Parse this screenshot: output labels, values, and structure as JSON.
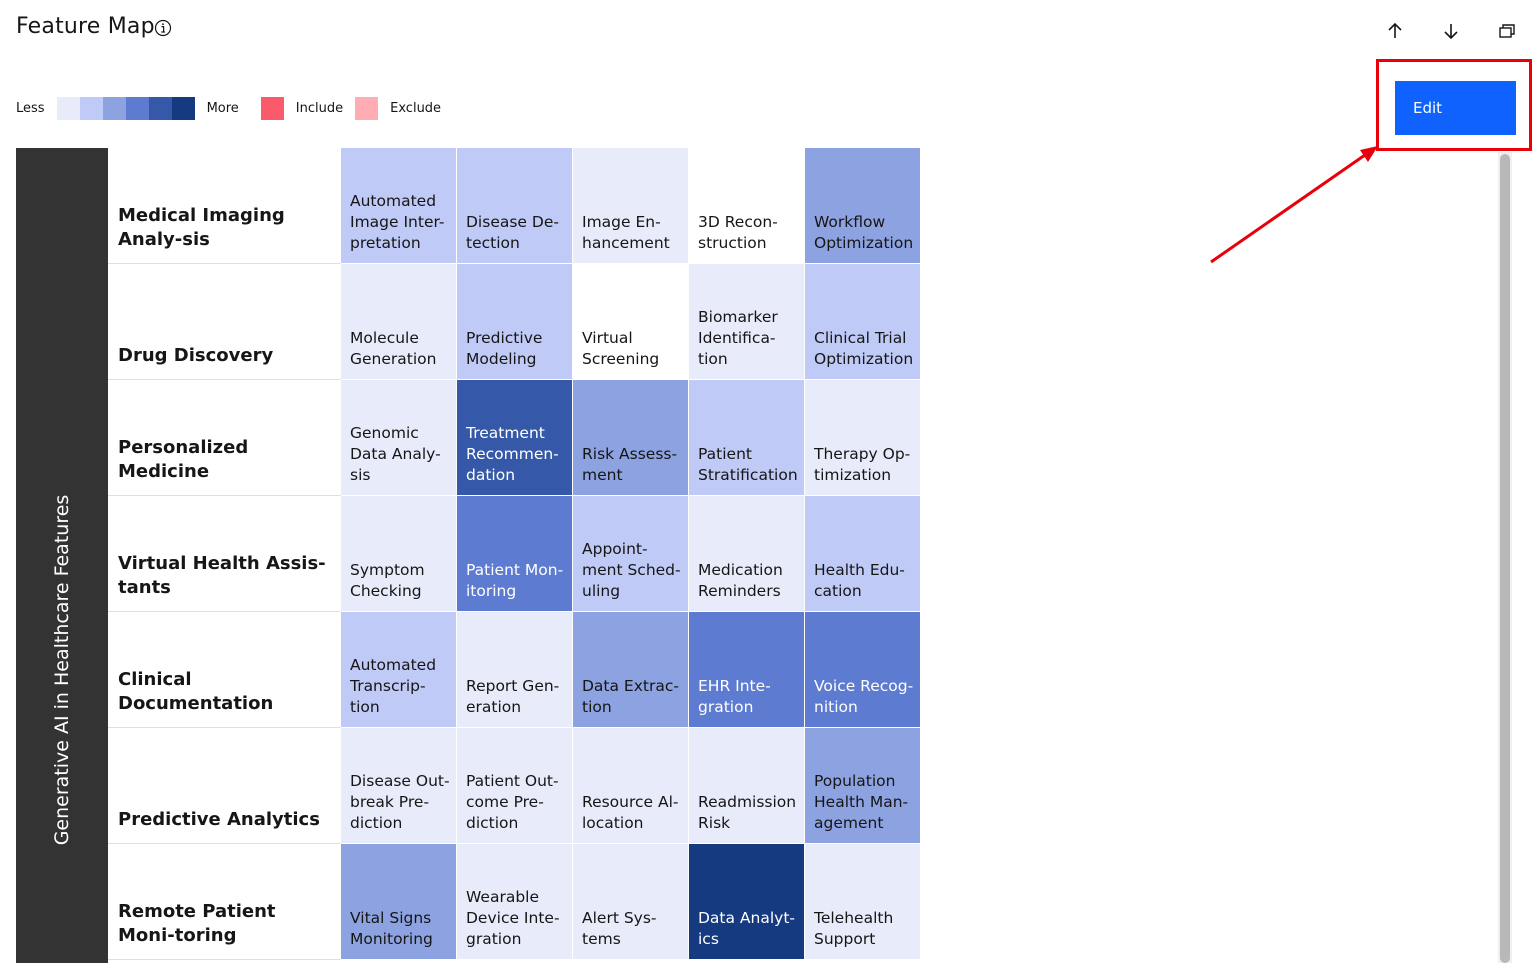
{
  "header": {
    "title": "Feature Map"
  },
  "legend": {
    "less": "Less",
    "more": "More",
    "scale_colors": [
      "#e8ebfa",
      "#bfcaf6",
      "#8da2e1",
      "#5d7bd0",
      "#3558a8",
      "#153a80"
    ],
    "include_label": "Include",
    "include_color": "#fa5a6a",
    "exclude_label": "Exclude",
    "exclude_color": "#ffadb3"
  },
  "toolbar": {
    "edit_label": "Edit",
    "accent_color": "#0f62fe"
  },
  "map": {
    "side_label": "Generative AI in Healthcare Features",
    "rows": [
      {
        "label": "Medical Imaging Analy-sis",
        "cells": [
          {
            "text": "Automated Image Inter-pretation",
            "level": 2
          },
          {
            "text": "Disease De-tection",
            "level": 2
          },
          {
            "text": "Image En-hancement",
            "level": 1
          },
          {
            "text": "3D Recon-struction",
            "level": 0
          },
          {
            "text": "Workflow Optimization",
            "level": 3
          }
        ]
      },
      {
        "label": "Drug Discovery",
        "cells": [
          {
            "text": "Molecule Generation",
            "level": 1
          },
          {
            "text": "Predictive Modeling",
            "level": 2
          },
          {
            "text": "Virtual Screening",
            "level": 0
          },
          {
            "text": "Biomarker Identifica-tion",
            "level": 1
          },
          {
            "text": "Clinical Trial Optimization",
            "level": 2
          }
        ]
      },
      {
        "label": "Personalized Medicine",
        "cells": [
          {
            "text": "Genomic Data Analy-sis",
            "level": 1
          },
          {
            "text": "Treatment Recommen-dation",
            "level": 5
          },
          {
            "text": "Risk Assess-ment",
            "level": 3
          },
          {
            "text": "Patient Stratification",
            "level": 2
          },
          {
            "text": "Therapy Op-timization",
            "level": 1
          }
        ]
      },
      {
        "label": "Virtual Health Assis-tants",
        "cells": [
          {
            "text": "Symptom Checking",
            "level": 1
          },
          {
            "text": "Patient Mon-itoring",
            "level": 4
          },
          {
            "text": "Appoint-ment Sched-uling",
            "level": 2
          },
          {
            "text": "Medication Reminders",
            "level": 1
          },
          {
            "text": "Health Edu-cation",
            "level": 2
          }
        ]
      },
      {
        "label": "Clinical Documentation",
        "cells": [
          {
            "text": "Automated Transcrip-tion",
            "level": 2
          },
          {
            "text": "Report Gen-eration",
            "level": 1
          },
          {
            "text": "Data Extrac-tion",
            "level": 3
          },
          {
            "text": "EHR Inte-gration",
            "level": 4
          },
          {
            "text": "Voice Recog-nition",
            "level": 4
          }
        ]
      },
      {
        "label": "Predictive Analytics",
        "cells": [
          {
            "text": "Disease Out-break Pre-diction",
            "level": 1
          },
          {
            "text": "Patient Out-come Pre-diction",
            "level": 1
          },
          {
            "text": "Resource Al-location",
            "level": 1
          },
          {
            "text": "Readmission Risk",
            "level": 1
          },
          {
            "text": "Population Health Man-agement",
            "level": 3
          }
        ]
      },
      {
        "label": "Remote Patient Moni-toring",
        "cells": [
          {
            "text": "Vital Signs Monitoring",
            "level": 3
          },
          {
            "text": "Wearable Device Inte-gration",
            "level": 1
          },
          {
            "text": "Alert Sys-tems",
            "level": 1
          },
          {
            "text": "Data Analyt-ics",
            "level": 6
          },
          {
            "text": "Telehealth Support",
            "level": 1
          }
        ]
      }
    ]
  }
}
